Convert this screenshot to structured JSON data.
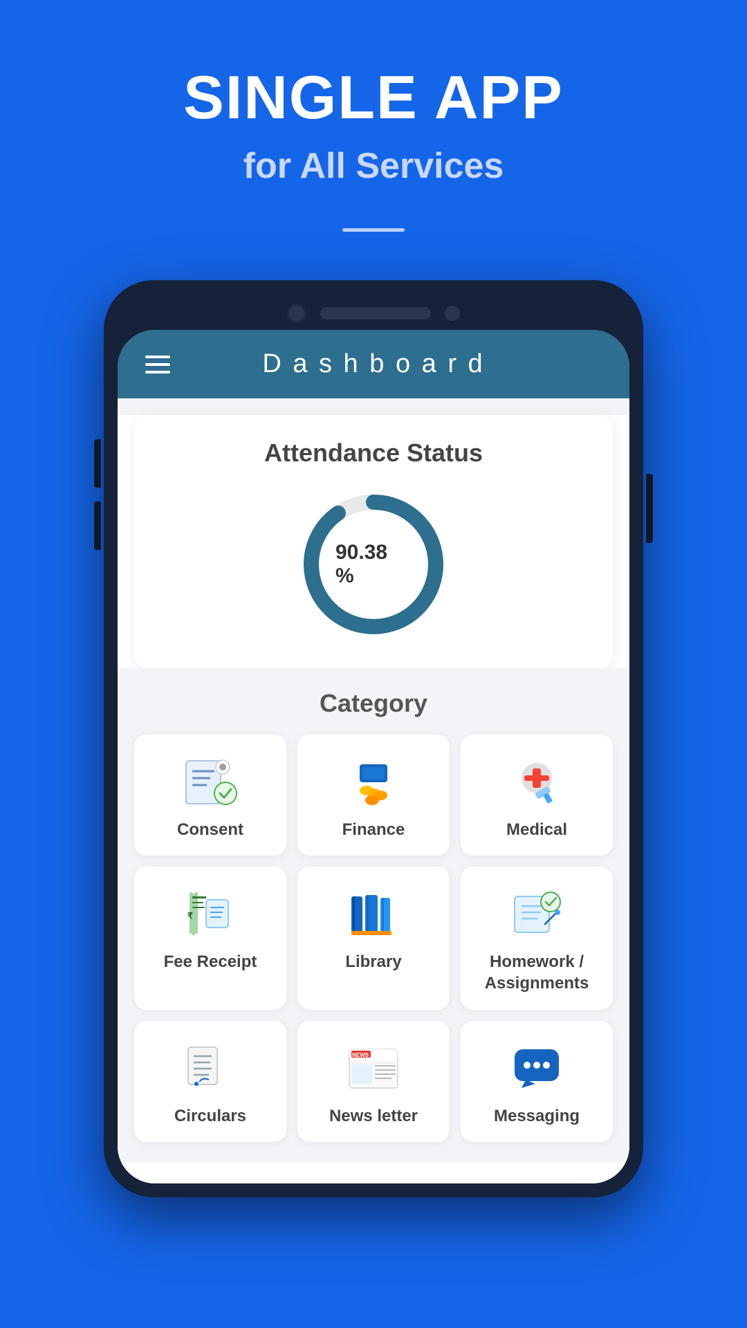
{
  "hero": {
    "title": "SINGLE APP",
    "subtitle": "for All Services"
  },
  "phone": {
    "header": {
      "title": "D a s h b o a r d"
    },
    "attendance": {
      "title": "Attendance Status",
      "percentage": "90.38 %"
    },
    "category": {
      "title": "Category",
      "items": [
        {
          "id": "consent",
          "label": "Consent",
          "icon": "consent"
        },
        {
          "id": "finance",
          "label": "Finance",
          "icon": "finance"
        },
        {
          "id": "medical",
          "label": "Medical",
          "icon": "medical"
        },
        {
          "id": "fee-receipt",
          "label": "Fee Receipt",
          "icon": "fee-receipt"
        },
        {
          "id": "library",
          "label": "Library",
          "icon": "library"
        },
        {
          "id": "homework",
          "label": "Homework /\nAssignments",
          "icon": "homework"
        },
        {
          "id": "circulars",
          "label": "Circulars",
          "icon": "circulars"
        },
        {
          "id": "newsletter",
          "label": "News letter",
          "icon": "newsletter"
        },
        {
          "id": "messaging",
          "label": "Messaging",
          "icon": "messaging"
        }
      ]
    }
  }
}
